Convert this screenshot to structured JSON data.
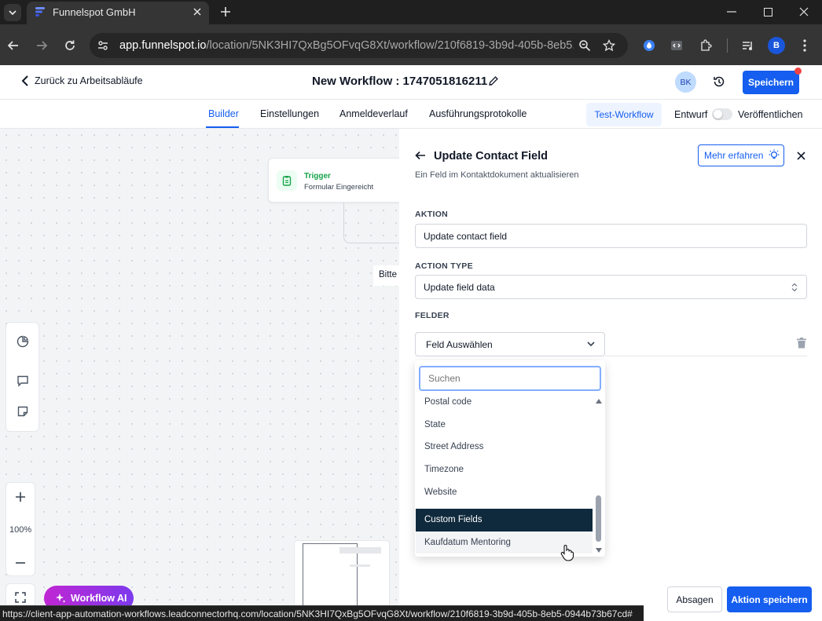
{
  "browser": {
    "tab_title": "Funnelspot GmbH",
    "url_domain": "app.funnelspot.io",
    "url_path": "/location/5NK3HI7QxBg5OFvqG8Xt/workflow/210f6819-3b9d-405b-8eb5...",
    "profile_initial": "B",
    "status_url": "https://client-app-automation-workflows.leadconnectorhq.com/location/5NK3HI7QxBg5OFvqG8Xt/workflow/210f6819-3b9d-405b-8eb5-0944b73b67cd#"
  },
  "header": {
    "back_label": "Zurück zu Arbeitsabläufe",
    "workflow_title": "New Workflow : 1747051816211",
    "avatar_initials": "BK",
    "save_label": "Speichern"
  },
  "nav": {
    "tabs": [
      "Builder",
      "Einstellungen",
      "Anmeldeverlauf",
      "Ausführungsprotokolle"
    ],
    "active_tab": "Builder",
    "test_label": "Test-Workflow",
    "draft_label": "Entwurf",
    "publish_label": "Veröffentlichen"
  },
  "canvas": {
    "trigger_title": "Trigger",
    "trigger_subtitle": "Formular Eingereicht",
    "partial_text": "Bitte",
    "zoom_level": "100%",
    "ai_label": "Workflow AI"
  },
  "panel": {
    "title": "Update Contact Field",
    "subtitle": "Ein Feld im Kontaktdokument aktualisieren",
    "learn_more": "Mehr erfahren",
    "action_label": "AKTION",
    "action_value": "Update contact field",
    "action_type_label": "ACTION TYPE",
    "action_type_value": "Update field data",
    "fields_label": "FELDER",
    "field_select": "Feld Auswählen",
    "search_placeholder": "Suchen",
    "options": [
      "Postal code",
      "State",
      "Street Address",
      "Timezone",
      "Website"
    ],
    "group_header": "Custom Fields",
    "custom_options": [
      "Kaufdatum Mentoring"
    ],
    "cancel_label": "Absagen",
    "save_action_label": "Aktion speichern"
  },
  "colors": {
    "primary": "#155eef",
    "active_tab": "#155eef",
    "group_header_bg": "#0f2a3d",
    "trigger_green": "#16a34a",
    "ai_purple": "#a21caf"
  }
}
